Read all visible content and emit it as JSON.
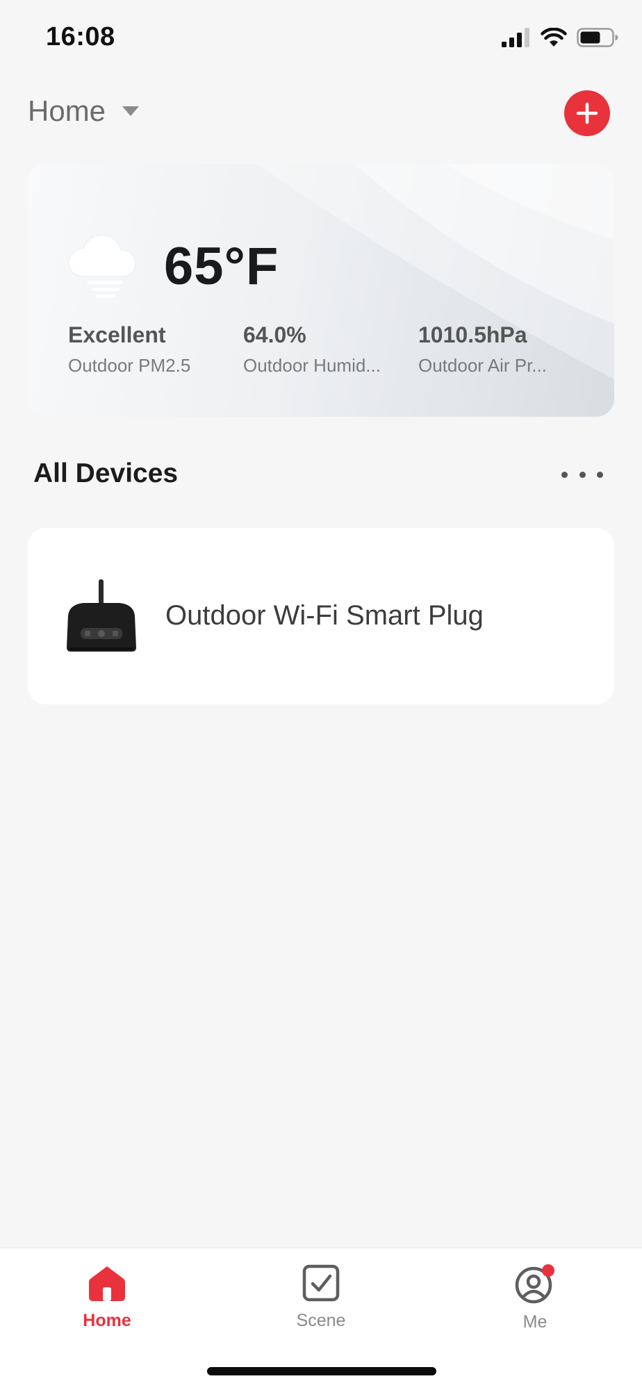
{
  "status_bar": {
    "time": "16:08"
  },
  "header": {
    "home_title": "Home"
  },
  "weather": {
    "temperature": "65°F",
    "metrics": [
      {
        "value": "Excellent",
        "label": "Outdoor PM2.5"
      },
      {
        "value": "64.0%",
        "label": "Outdoor Humid..."
      },
      {
        "value": "1010.5hPa",
        "label": "Outdoor Air Pr..."
      }
    ]
  },
  "devices_section": {
    "title": "All Devices",
    "devices": [
      {
        "name": "Outdoor Wi-Fi Smart Plug"
      }
    ]
  },
  "tab_bar": {
    "tabs": [
      {
        "label": "Home",
        "icon": "home-icon",
        "active": true
      },
      {
        "label": "Scene",
        "icon": "scene-check-icon",
        "active": false
      },
      {
        "label": "Me",
        "icon": "profile-icon",
        "active": false,
        "notification_dot": true
      }
    ]
  },
  "colors": {
    "accent": "#e8323c",
    "background": "#f6f6f6",
    "card": "#ffffff"
  }
}
